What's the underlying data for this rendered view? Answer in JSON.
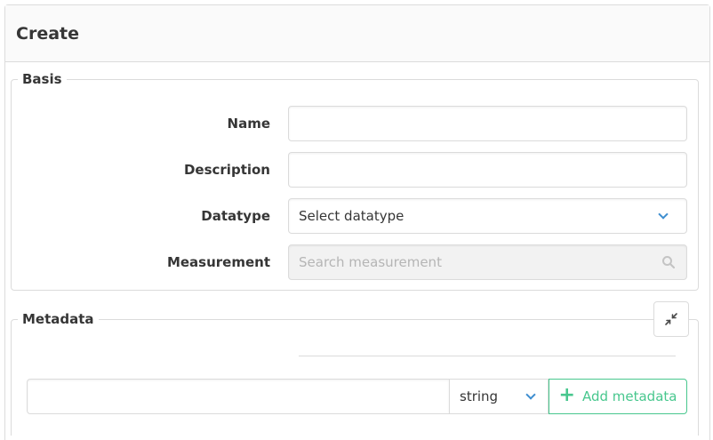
{
  "card": {
    "title": "Create"
  },
  "basis": {
    "legend": "Basis",
    "name": {
      "label": "Name",
      "value": ""
    },
    "description": {
      "label": "Description",
      "value": ""
    },
    "datatype": {
      "label": "Datatype",
      "selected": "Select datatype"
    },
    "measurement": {
      "label": "Measurement",
      "placeholder": "Search measurement"
    }
  },
  "metadata": {
    "legend": "Metadata",
    "key_value": "",
    "type_selected": "string",
    "add_label": "Add metadata"
  },
  "icons": {
    "chevron": "chevron-down-icon",
    "search": "search-icon",
    "compress": "compress-icon",
    "plus": "plus-icon"
  },
  "colors": {
    "accent": "#3e8ed0",
    "success": "#48c78e"
  }
}
